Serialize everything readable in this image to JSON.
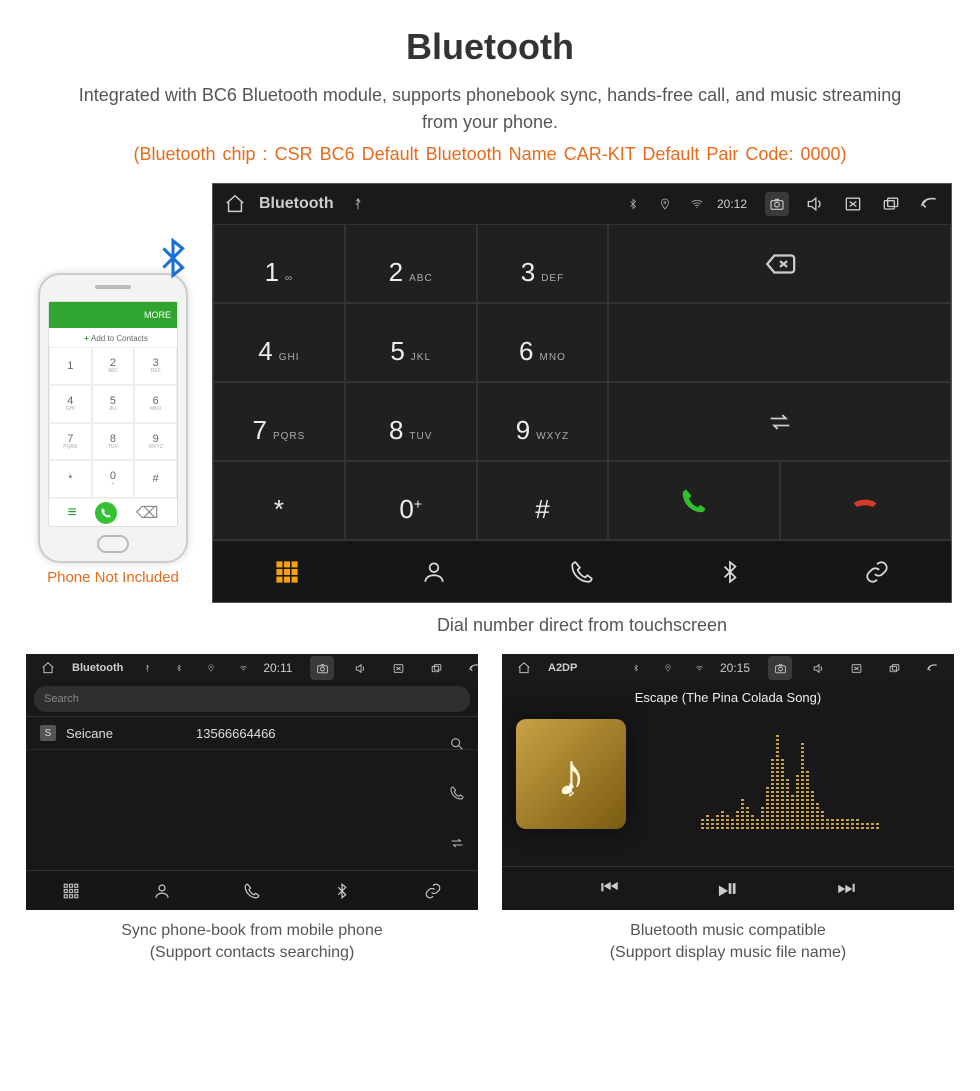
{
  "page": {
    "title": "Bluetooth",
    "subtitle": "Integrated with BC6 Bluetooth module, supports phonebook sync, hands-free call, and music streaming from your phone.",
    "specs": "(Bluetooth chip : CSR BC6     Default Bluetooth Name CAR-KIT     Default Pair Code: 0000)"
  },
  "phone": {
    "caption": "Phone Not Included",
    "header": "MORE",
    "add_contacts": "Add to Contacts",
    "pad": [
      {
        "n": "1",
        "s": ""
      },
      {
        "n": "2",
        "s": "ABC"
      },
      {
        "n": "3",
        "s": "DEF"
      },
      {
        "n": "4",
        "s": "GHI"
      },
      {
        "n": "5",
        "s": "JKL"
      },
      {
        "n": "6",
        "s": "MNO"
      },
      {
        "n": "7",
        "s": "PQRS"
      },
      {
        "n": "8",
        "s": "TUV"
      },
      {
        "n": "9",
        "s": "WXYZ"
      },
      {
        "n": "*",
        "s": ""
      },
      {
        "n": "0",
        "s": "+"
      },
      {
        "n": "#",
        "s": ""
      }
    ]
  },
  "dialer": {
    "status": {
      "title": "Bluetooth",
      "time": "20:12"
    },
    "caption": "Dial number direct from touchscreen",
    "keys": [
      {
        "n": "1",
        "s": "∞"
      },
      {
        "n": "2",
        "s": "ABC"
      },
      {
        "n": "3",
        "s": "DEF"
      },
      {
        "n": "4",
        "s": "GHI"
      },
      {
        "n": "5",
        "s": "JKL"
      },
      {
        "n": "6",
        "s": "MNO"
      },
      {
        "n": "7",
        "s": "PQRS"
      },
      {
        "n": "8",
        "s": "TUV"
      },
      {
        "n": "9",
        "s": "WXYZ"
      },
      {
        "n": "*",
        "s": ""
      },
      {
        "n": "0",
        "s": "+",
        "plus": true
      },
      {
        "n": "#",
        "s": ""
      }
    ]
  },
  "contacts": {
    "status": {
      "title": "Bluetooth",
      "time": "20:11"
    },
    "search_placeholder": "Search",
    "row": {
      "badge": "S",
      "name": "Seicane",
      "number": "13566664466"
    },
    "caption_l1": "Sync phone-book from mobile phone",
    "caption_l2": "(Support contacts searching)"
  },
  "music": {
    "status": {
      "title": "A2DP",
      "time": "20:15"
    },
    "song": "Escape (The Pina Colada Song)",
    "viz_heights": [
      10,
      14,
      10,
      16,
      20,
      14,
      10,
      18,
      32,
      22,
      14,
      10,
      24,
      44,
      72,
      96,
      72,
      50,
      34,
      56,
      86,
      60,
      40,
      26,
      18,
      12,
      10,
      10,
      10,
      10,
      10,
      10,
      8,
      8,
      8,
      8
    ],
    "caption_l1": "Bluetooth music compatible",
    "caption_l2": "(Support display music file name)"
  }
}
